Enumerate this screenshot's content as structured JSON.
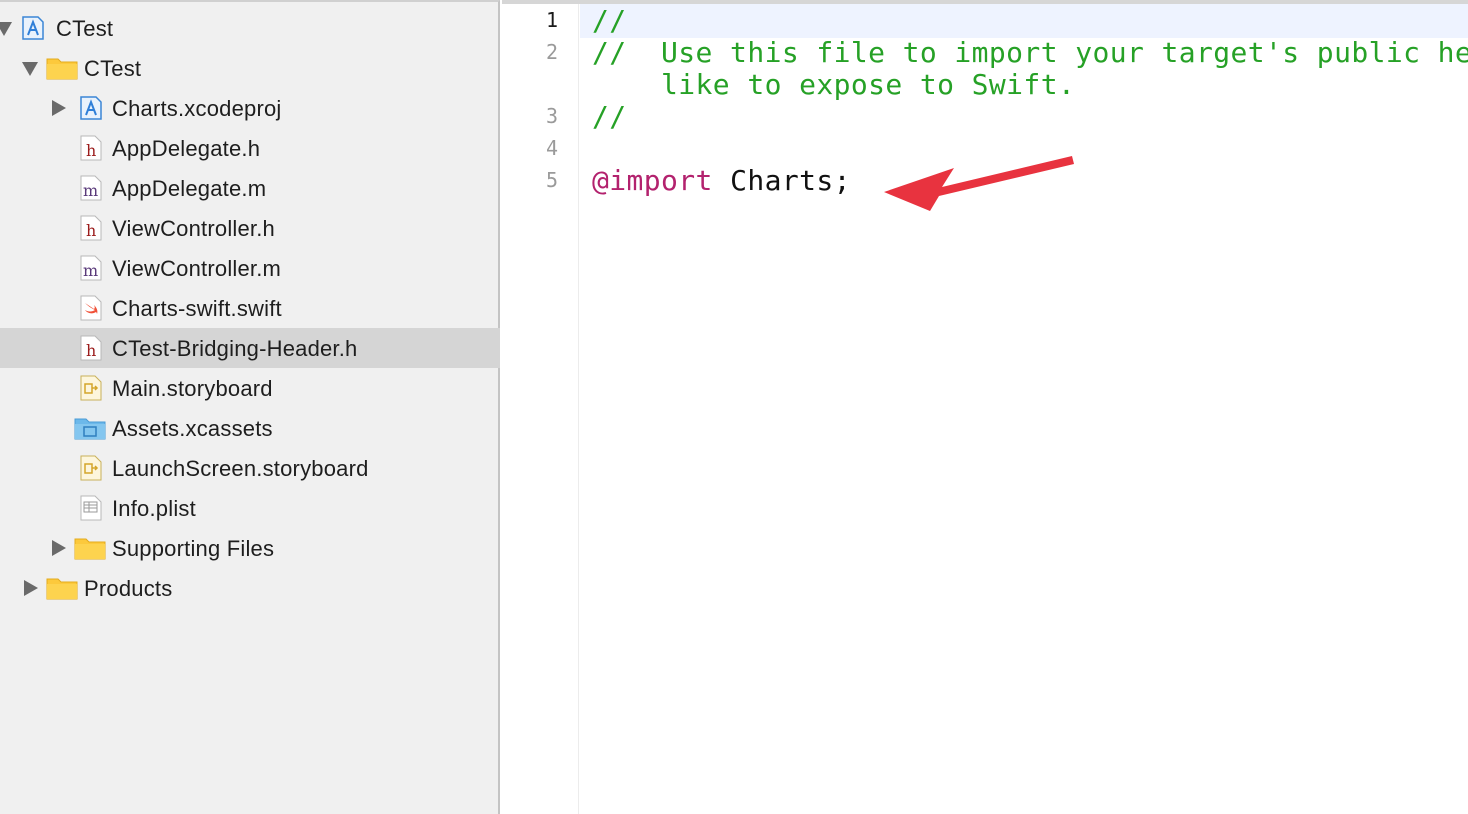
{
  "navigator": {
    "items": [
      {
        "label": "CTest",
        "icon": "xcode-project-icon"
      },
      {
        "label": "CTest",
        "icon": "folder-icon"
      },
      {
        "label": "Charts.xcodeproj",
        "icon": "xcode-project-icon"
      },
      {
        "label": "AppDelegate.h",
        "icon": "header-file-icon",
        "glyph": "h"
      },
      {
        "label": "AppDelegate.m",
        "icon": "objc-file-icon",
        "glyph": "m"
      },
      {
        "label": "ViewController.h",
        "icon": "header-file-icon",
        "glyph": "h"
      },
      {
        "label": "ViewController.m",
        "icon": "objc-file-icon",
        "glyph": "m"
      },
      {
        "label": "Charts-swift.swift",
        "icon": "swift-file-icon"
      },
      {
        "label": "CTest-Bridging-Header.h",
        "icon": "header-file-icon",
        "glyph": "h",
        "selected": true
      },
      {
        "label": "Main.storyboard",
        "icon": "storyboard-icon"
      },
      {
        "label": "Assets.xcassets",
        "icon": "asset-catalog-icon"
      },
      {
        "label": "LaunchScreen.storyboard",
        "icon": "storyboard-icon"
      },
      {
        "label": "Info.plist",
        "icon": "plist-icon"
      },
      {
        "label": "Supporting Files",
        "icon": "folder-icon"
      },
      {
        "label": "Products",
        "icon": "folder-icon"
      }
    ]
  },
  "editor": {
    "line_numbers": [
      "1",
      "2",
      "3",
      "4",
      "5"
    ],
    "lines": {
      "l1": "//",
      "l2a": "//  Use this file to import your target's public he",
      "l2b": "    like to expose to Swift.",
      "l3": "//",
      "l5_kw": "@import",
      "l5_rest": " Charts;"
    }
  },
  "colors": {
    "comment": "#26a126",
    "keyword": "#b3226e",
    "selection": "#d5d5d5",
    "arrow": "#e8333f"
  }
}
